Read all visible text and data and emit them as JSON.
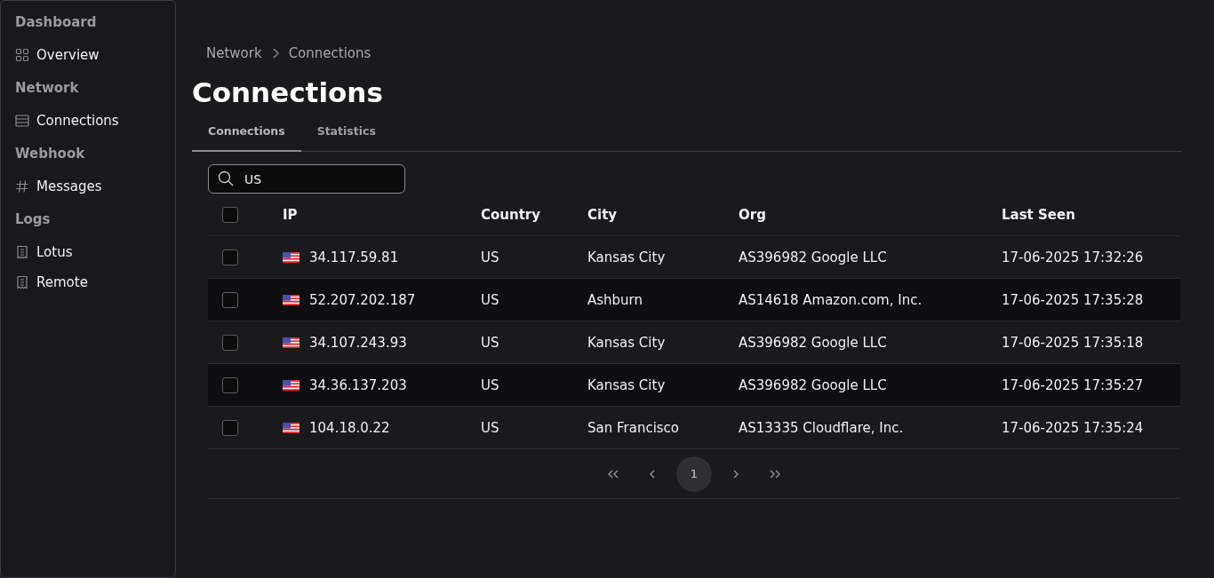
{
  "sidebar": {
    "groups": [
      {
        "heading": "Dashboard",
        "items": [
          {
            "label": "Overview",
            "kind": "grid"
          }
        ]
      },
      {
        "heading": "Network",
        "items": [
          {
            "label": "Connections",
            "kind": "server"
          }
        ]
      },
      {
        "heading": "Webhook",
        "items": [
          {
            "label": "Messages",
            "kind": "hash"
          }
        ]
      },
      {
        "heading": "Logs",
        "items": [
          {
            "label": "Lotus",
            "kind": "receipt"
          },
          {
            "label": "Remote",
            "kind": "receipt"
          }
        ]
      }
    ]
  },
  "breadcrumb": [
    "Network",
    "Connections"
  ],
  "title": "Connections",
  "tabs": [
    {
      "label": "Connections",
      "selected": true
    },
    {
      "label": "Statistics",
      "selected": false
    }
  ],
  "search": {
    "value": "US"
  },
  "table": {
    "select_all_checked": false,
    "columns": [
      "IP",
      "Country",
      "City",
      "Org",
      "Last Seen"
    ],
    "rows": [
      {
        "checked": false,
        "ip": "34.117.59.81",
        "country": "US",
        "city": "Kansas City",
        "org": "AS396982 Google LLC",
        "last_seen": "17-06-2025 17:32:26"
      },
      {
        "checked": false,
        "ip": "52.207.202.187",
        "country": "US",
        "city": "Ashburn",
        "org": "AS14618 Amazon.com, Inc.",
        "last_seen": "17-06-2025 17:35:28"
      },
      {
        "checked": false,
        "ip": "34.107.243.93",
        "country": "US",
        "city": "Kansas City",
        "org": "AS396982 Google LLC",
        "last_seen": "17-06-2025 17:35:18"
      },
      {
        "checked": false,
        "ip": "34.36.137.203",
        "country": "US",
        "city": "Kansas City",
        "org": "AS396982 Google LLC",
        "last_seen": "17-06-2025 17:35:27"
      },
      {
        "checked": false,
        "ip": "104.18.0.22",
        "country": "US",
        "city": "San Francisco",
        "org": "AS13335 Cloudflare, Inc.",
        "last_seen": "17-06-2025 17:35:24"
      }
    ]
  },
  "pagination": {
    "pages": [
      {
        "label": "1",
        "selected": true
      }
    ]
  }
}
